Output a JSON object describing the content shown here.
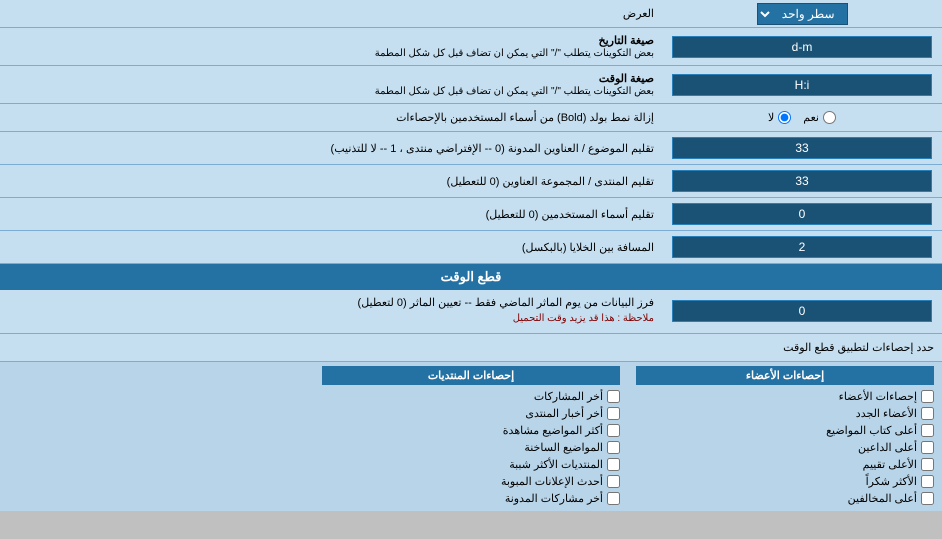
{
  "page": {
    "title": "العرض",
    "date_format_label": "صيغة التاريخ",
    "date_format_note": "بعض التكوينات يتطلب \"/\" التي يمكن ان تضاف قبل كل شكل المطمة",
    "date_format_value": "d-m",
    "time_format_label": "صيغة الوقت",
    "time_format_note": "بعض التكوينات يتطلب \"/\" التي يمكن ان تضاف قبل كل شكل المطمة",
    "time_format_value": "H:i",
    "bold_label": "إزالة نمط بولد (Bold) من أسماء المستخدمين بالإحصاءات",
    "bold_yes": "نعم",
    "bold_no": "لا",
    "topic_order_label": "تقليم الموضوع / العناوين المدونة (0 -- الإفتراضي منتدى ، 1 -- لا للتذنيب)",
    "topic_order_value": "33",
    "forum_order_label": "تقليم المنتدى / المجموعة العناوين (0 للتعطيل)",
    "forum_order_value": "33",
    "usernames_label": "تقليم أسماء المستخدمين (0 للتعطيل)",
    "usernames_value": "0",
    "spacing_label": "المسافة بين الخلايا (بالبكسل)",
    "spacing_value": "2",
    "cut_section_title": "قطع الوقت",
    "cut_label": "فرز البيانات من يوم الماثر الماضي فقط -- تعيين الماثر (0 لتعطيل)",
    "cut_note": "ملاحظة : هذا قد يزيد وقت التحميل",
    "cut_value": "0",
    "stats_limit_label": "حدد إحصاءات لتطبيق قطع الوقت",
    "stats_posts_label": "إحصاءات المنتديات",
    "stats_posts_header": "إحصاءات المنتديات",
    "stats_members_header": "إحصاءات الأعضاء",
    "checkboxes_posts": [
      "أخر المشاركات",
      "أخر أخبار المنتدى",
      "أكثر المواضيع مشاهدة",
      "المواضيع الساخنة",
      "المنتديات الأكثر شببة",
      "أحدث الإعلانات المبوبة",
      "أخر مشاركات المدونة"
    ],
    "checkboxes_members": [
      "إحصاءات الأعضاء",
      "الأعضاء الجدد",
      "أعلى كتاب المواضيع",
      "أعلى الداعين",
      "الأعلى تقييم",
      "الأكثر شكراً",
      "أعلى المخالفين"
    ],
    "display_mode_label": "العرض",
    "display_mode_value": "سطر واحد"
  }
}
